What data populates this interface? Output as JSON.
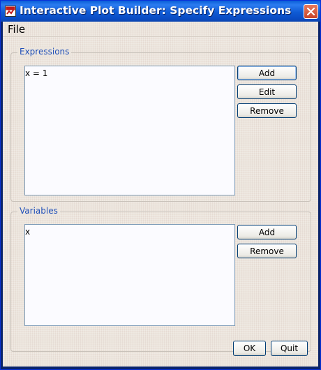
{
  "window": {
    "title": "Interactive Plot Builder: Specify Expressions",
    "icons": {
      "app": "app-icon",
      "close": "close-icon"
    }
  },
  "menu": {
    "file": "File"
  },
  "expressions": {
    "title": "Expressions",
    "items": [
      "x = 1"
    ],
    "buttons": {
      "add": "Add",
      "edit": "Edit",
      "remove": "Remove"
    }
  },
  "variables": {
    "title": "Variables",
    "items": [
      "x"
    ],
    "buttons": {
      "add": "Add",
      "remove": "Remove"
    }
  },
  "footer": {
    "ok": "OK",
    "quit": "Quit"
  },
  "colors": {
    "titlebar_blue": "#0a5fd8",
    "group_title": "#1f4fb8",
    "close_red": "#d8593a",
    "window_bg": "#ece5dd"
  }
}
